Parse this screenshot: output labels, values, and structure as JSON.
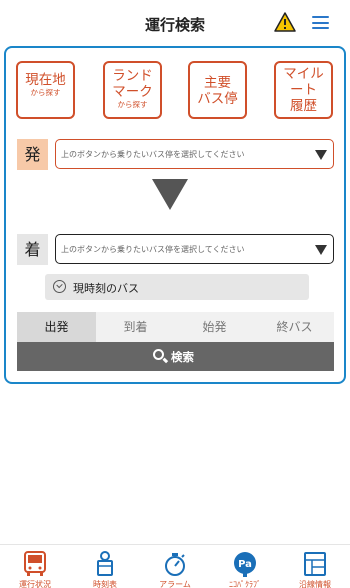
{
  "header": {
    "title": "運行検索"
  },
  "quick_buttons": [
    {
      "main_line1": "現在地",
      "main_line2": "",
      "main_line3": "",
      "sub": "から探す"
    },
    {
      "main_line1": "ランド",
      "main_line2": "マーク",
      "main_line3": "",
      "sub": "から探す"
    },
    {
      "main_line1": "主要",
      "main_line2": "バス停",
      "main_line3": "",
      "sub": ""
    },
    {
      "main_line1": "マイル",
      "main_line2": "ート",
      "main_line3": "履歴",
      "sub": ""
    }
  ],
  "departure": {
    "label": "発",
    "placeholder": "上のボタンから乗りたいバス停を選択してください"
  },
  "arrival": {
    "label": "着",
    "placeholder": "上のボタンから乗りたいバス停を選択してください"
  },
  "time_option": "現時刻のバス",
  "tabs": [
    {
      "label": "出発",
      "active": true
    },
    {
      "label": "到着",
      "active": false
    },
    {
      "label": "始発",
      "active": false
    },
    {
      "label": "終バス",
      "active": false
    }
  ],
  "search_button": "検索",
  "bottom_nav": [
    {
      "label": "運行状況",
      "icon": "bus-icon"
    },
    {
      "label": "時刻表",
      "icon": "bus-stop-icon"
    },
    {
      "label": "アラーム",
      "icon": "stopwatch-icon"
    },
    {
      "label": "ﾆｺﾊﾟｸﾗﾌﾞ",
      "icon": "nicopa-club-icon"
    },
    {
      "label": "沿線情報",
      "icon": "route-info-icon"
    }
  ],
  "colors": {
    "accent_red": "#d04f2a",
    "panel_border": "#1a86c9",
    "menu_blue": "#2a77c9",
    "warning_yellow": "#f5c400",
    "departure_label_bg": "#f7c9a8",
    "search_button_bg": "#666666"
  }
}
